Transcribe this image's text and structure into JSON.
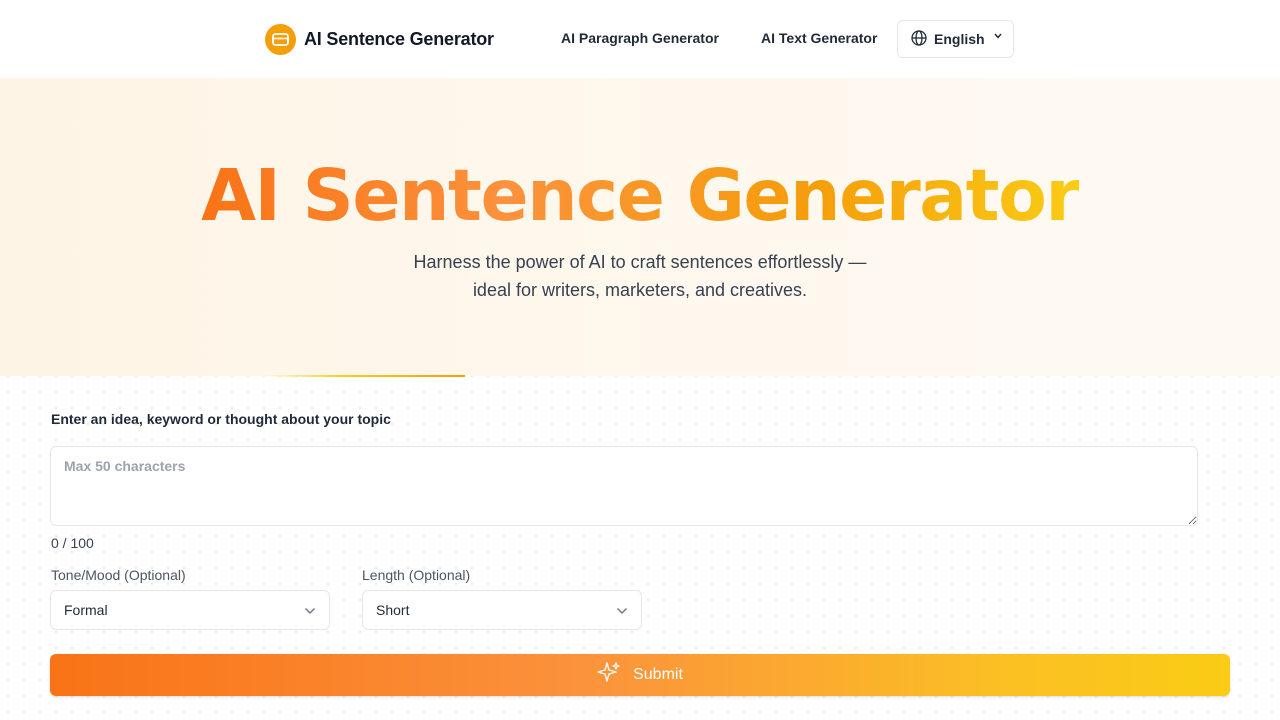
{
  "header": {
    "logo_text": "AI Sentence Generator",
    "nav": [
      {
        "label": "AI Paragraph Generator"
      },
      {
        "label": "AI Text Generator"
      }
    ],
    "language": "English"
  },
  "hero": {
    "title": "AI Sentence Generator",
    "subtitle_line1": "Harness the power of AI to craft sentences effortlessly —",
    "subtitle_line2": "ideal for writers, marketers, and creatives."
  },
  "form": {
    "topic_label": "Enter an idea, keyword or thought about your topic",
    "topic_placeholder": "Max 50 characters",
    "topic_value": "",
    "counter": "0 / 100",
    "tone_label": "Tone/Mood (Optional)",
    "tone_value": "Formal",
    "length_label": "Length (Optional)",
    "length_value": "Short",
    "submit_label": "Submit"
  },
  "colors": {
    "accent_orange": "#f97316",
    "accent_yellow": "#facc15",
    "logo_bg": "#f59e0b"
  },
  "icons": {
    "logo": "chat-bubble-icon",
    "language": "globe-icon",
    "dropdown": "chevron-down-icon",
    "submit": "sparkle-icon"
  }
}
